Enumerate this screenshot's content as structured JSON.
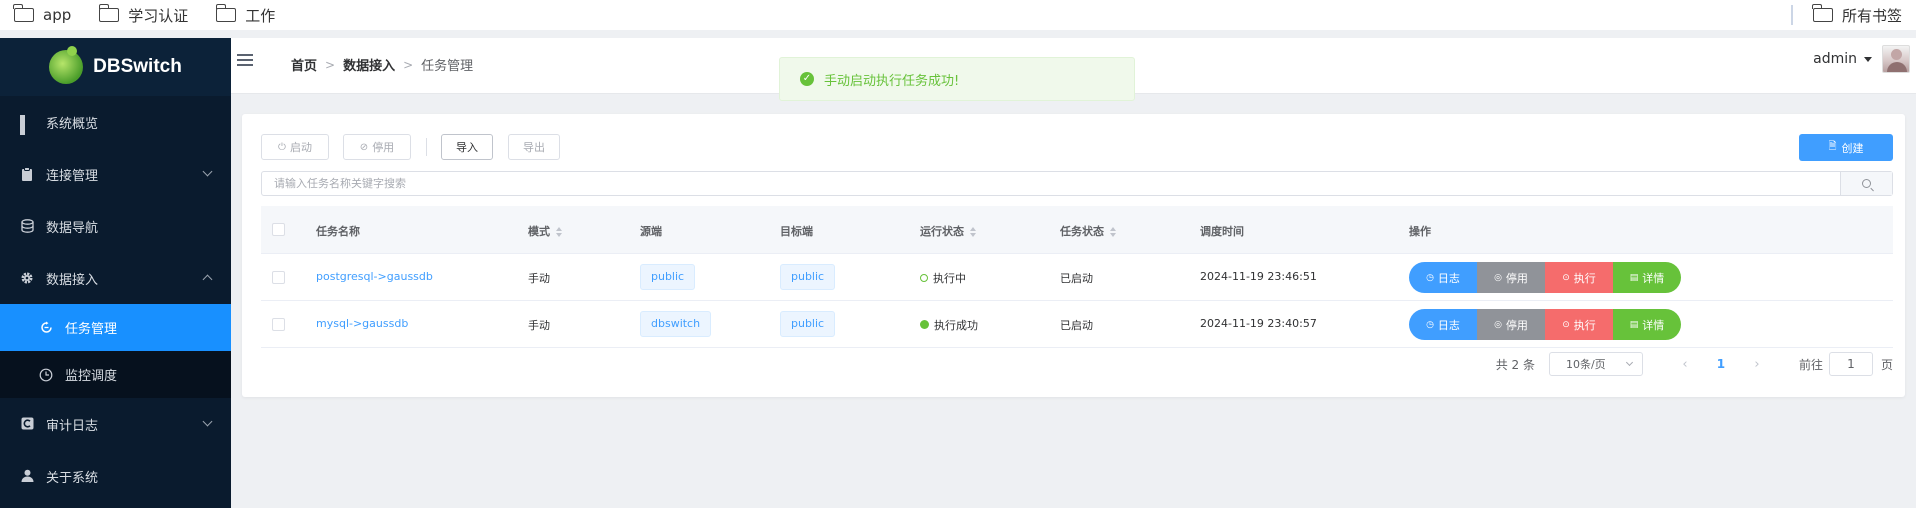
{
  "bookmarks": {
    "items": [
      {
        "label": "app"
      },
      {
        "label": "学习认证"
      },
      {
        "label": "工作"
      }
    ],
    "all_bookmarks": "所有书签"
  },
  "brand": {
    "name": "DBSwitch"
  },
  "sidebar": {
    "items": [
      {
        "label": "系统概览",
        "icon": "grid-icon"
      },
      {
        "label": "连接管理",
        "icon": "clipboard-icon",
        "expandable": true
      },
      {
        "label": "数据导航",
        "icon": "database-icon"
      },
      {
        "label": "数据接入",
        "icon": "gear-icon",
        "expanded": true
      },
      {
        "label": "任务管理",
        "icon": "refresh-icon",
        "sub": true,
        "active": true
      },
      {
        "label": "监控调度",
        "icon": "clock-icon",
        "sub": true
      },
      {
        "label": "审计日志",
        "icon": "audit-icon",
        "expandable": true
      },
      {
        "label": "关于系统",
        "icon": "user-icon"
      }
    ]
  },
  "header": {
    "breadcrumb": [
      "首页",
      "数据接入",
      "任务管理"
    ],
    "user": "admin"
  },
  "toast": {
    "message": "手动启动执行任务成功!",
    "type": "success"
  },
  "toolbar": {
    "start": "启动",
    "stop": "停用",
    "import": "导入",
    "export": "导出",
    "create": "创建"
  },
  "search": {
    "placeholder": "请输入任务名称关键字搜索",
    "value": ""
  },
  "table": {
    "columns": [
      "任务名称",
      "模式",
      "源端",
      "目标端",
      "运行状态",
      "任务状态",
      "调度时间",
      "操作"
    ],
    "rows": [
      {
        "name": "postgresql->gaussdb",
        "mode": "手动",
        "source": "public",
        "target": "public",
        "run_status": "执行中",
        "run_state": "running",
        "task_status": "已启动",
        "schedule_time": "2024-11-19 23:46:51"
      },
      {
        "name": "mysql->gaussdb",
        "mode": "手动",
        "source": "dbswitch",
        "target": "public",
        "run_status": "执行成功",
        "run_state": "success",
        "task_status": "已启动",
        "schedule_time": "2024-11-19 23:40:57"
      }
    ],
    "actions": {
      "log": "日志",
      "stop": "停用",
      "exec": "执行",
      "detail": "详情"
    }
  },
  "pagination": {
    "total": "共 2 条",
    "page_size": "10条/页",
    "current": "1",
    "goto_prefix": "前往",
    "goto_value": "1",
    "goto_suffix": "页"
  },
  "colors": {
    "primary": "#409eff",
    "success": "#67c23a",
    "danger": "#f56c6c",
    "info": "#909399",
    "sidebar_bg": "#0a1b2e",
    "active_menu": "#1890ff"
  }
}
